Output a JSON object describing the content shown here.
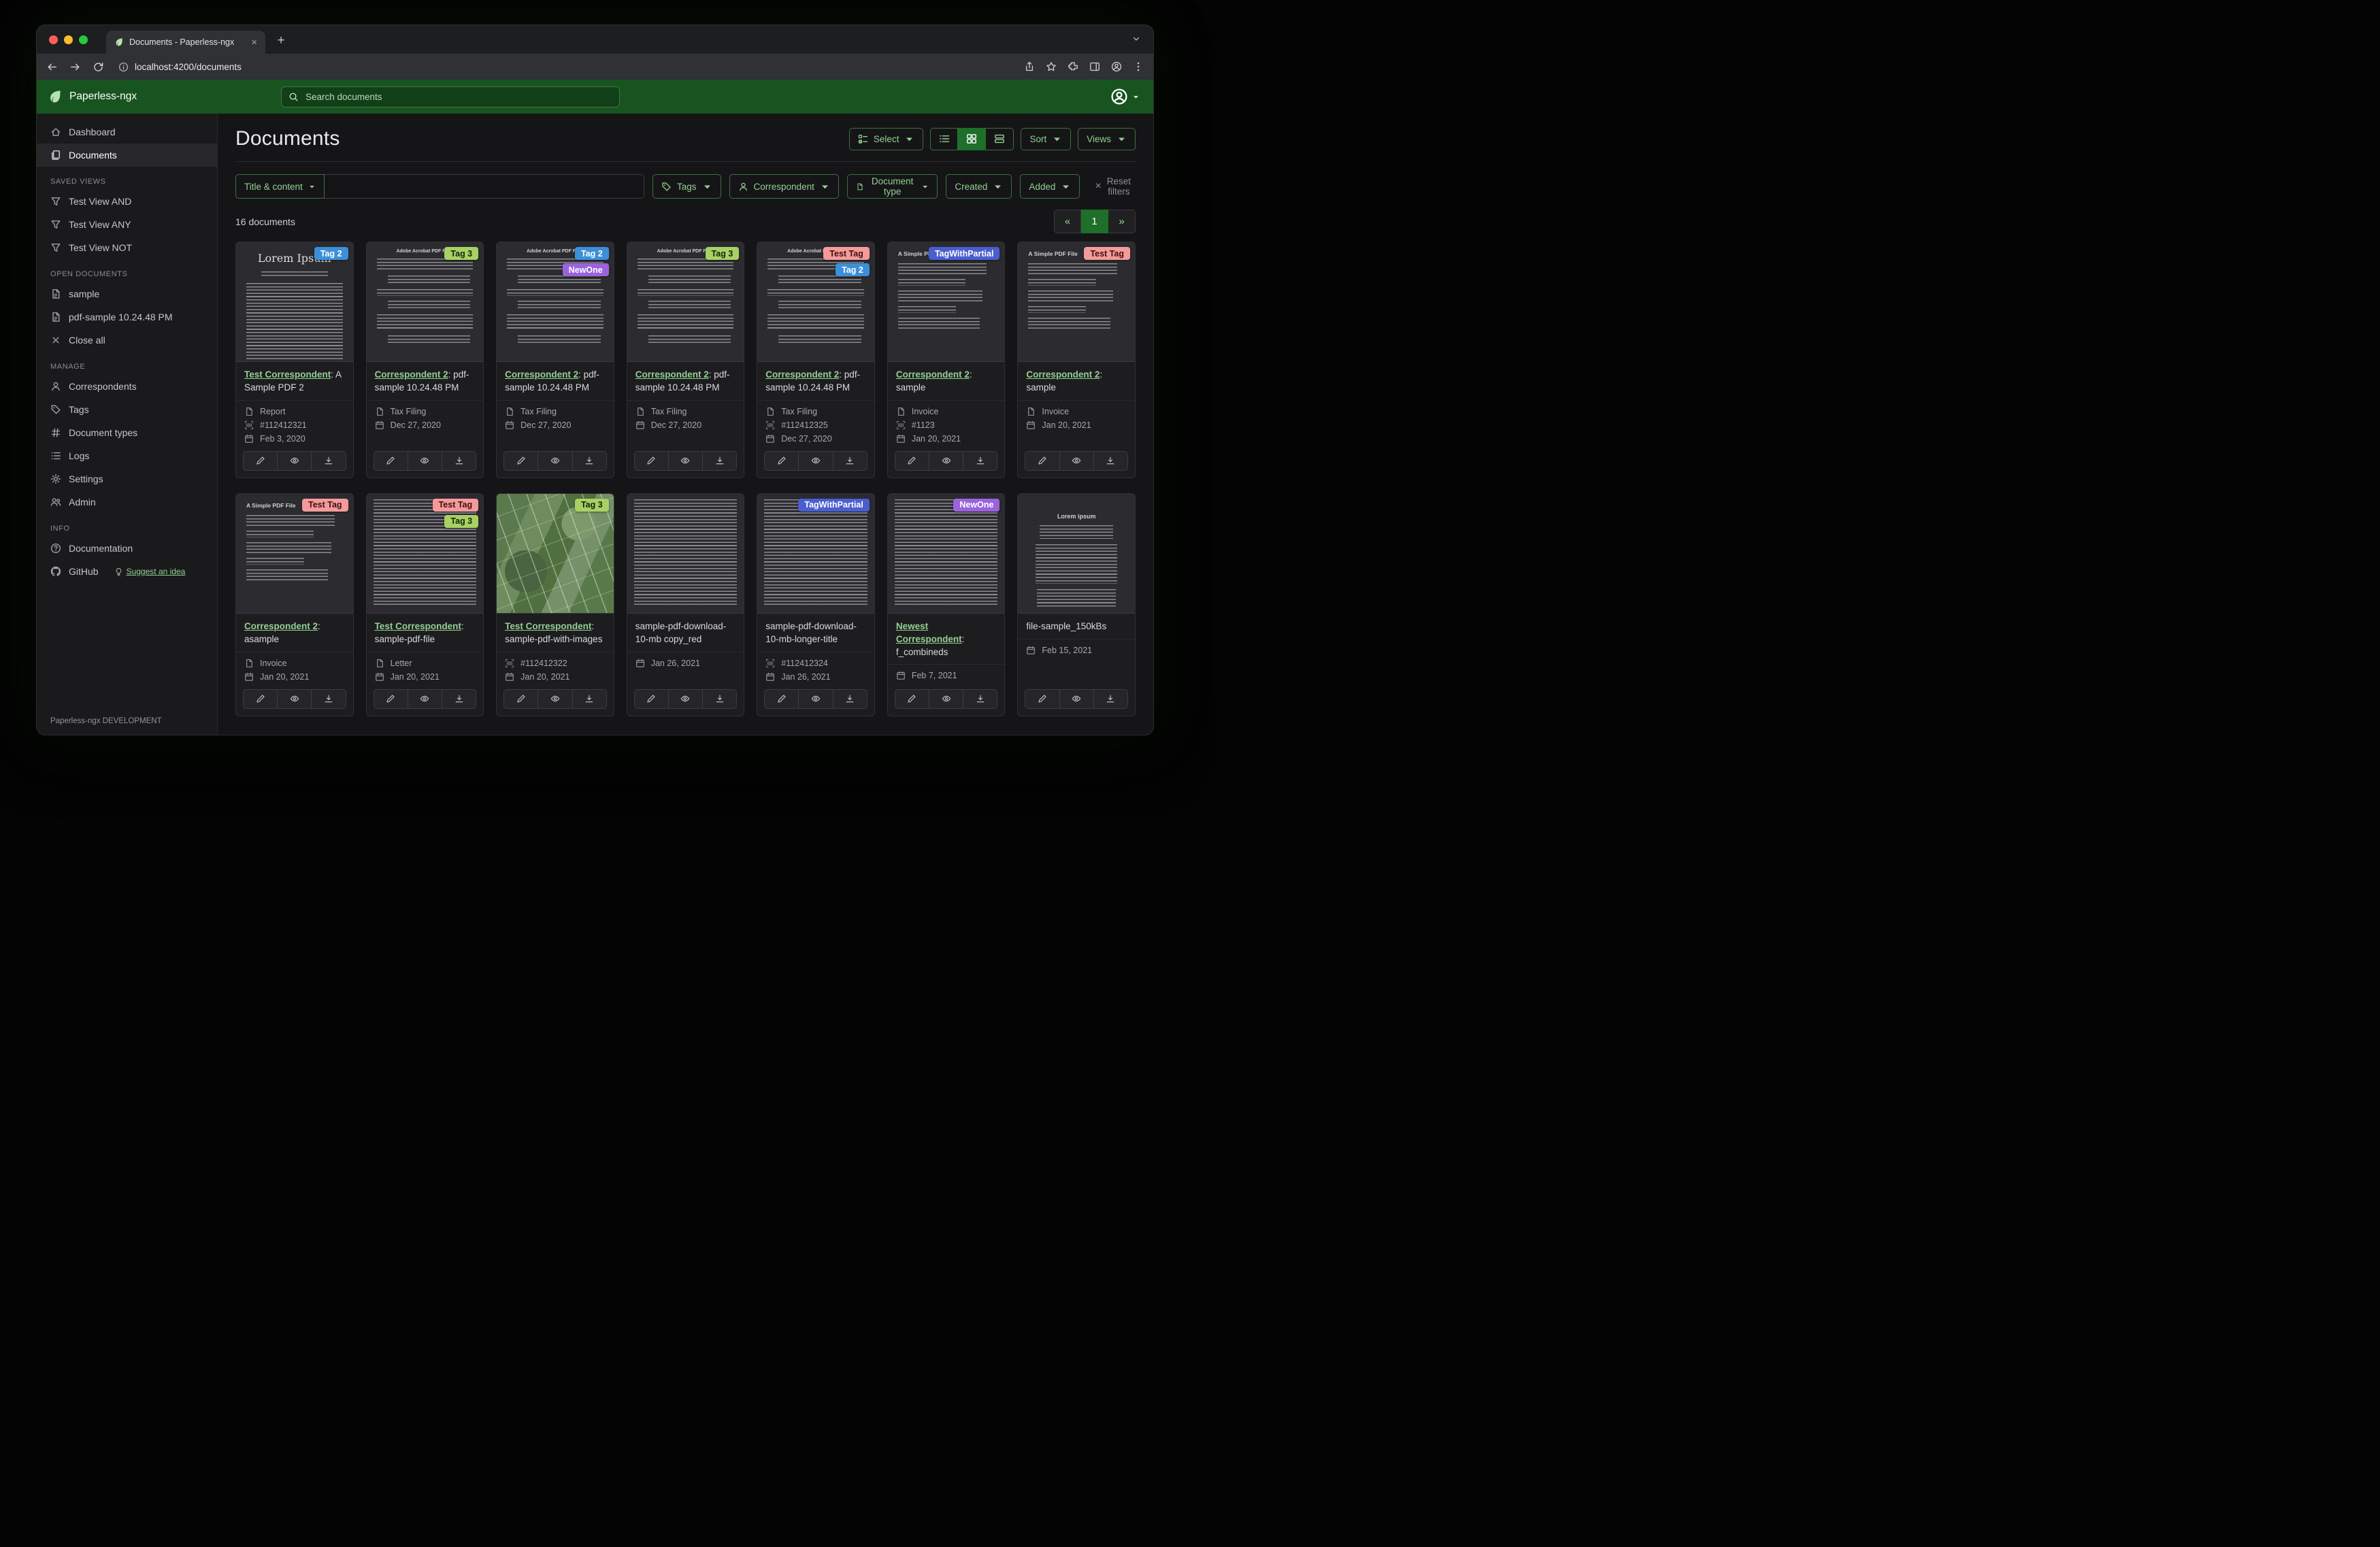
{
  "colors": {
    "header_green": "#17541f",
    "accent_green": "#94d092",
    "active_green": "#1e6f29"
  },
  "browser": {
    "tab": {
      "title": "Documents - Paperless-ngx",
      "close": "×"
    },
    "new_tab": "+",
    "url": "localhost:4200/documents"
  },
  "header": {
    "brand": "Paperless-ngx",
    "search_placeholder": "Search documents"
  },
  "sidebar": {
    "primary": [
      {
        "icon": "home",
        "label": "Dashboard",
        "active": false
      },
      {
        "icon": "files",
        "label": "Documents",
        "active": true
      }
    ],
    "sections": [
      {
        "title": "SAVED VIEWS",
        "items": [
          {
            "icon": "funnel",
            "label": "Test View AND"
          },
          {
            "icon": "funnel",
            "label": "Test View ANY"
          },
          {
            "icon": "funnel",
            "label": "Test View NOT"
          }
        ]
      },
      {
        "title": "OPEN DOCUMENTS",
        "items": [
          {
            "icon": "filetext",
            "label": "sample"
          },
          {
            "icon": "filetext",
            "label": "pdf-sample 10.24.48 PM"
          },
          {
            "icon": "x",
            "label": "Close all"
          }
        ]
      },
      {
        "title": "MANAGE",
        "items": [
          {
            "icon": "person",
            "label": "Correspondents"
          },
          {
            "icon": "tag",
            "label": "Tags"
          },
          {
            "icon": "hash",
            "label": "Document types"
          },
          {
            "icon": "list",
            "label": "Logs"
          },
          {
            "icon": "gear",
            "label": "Settings"
          },
          {
            "icon": "people",
            "label": "Admin"
          }
        ]
      },
      {
        "title": "INFO",
        "items": [
          {
            "icon": "question",
            "label": "Documentation"
          },
          {
            "icon": "github",
            "label": "GitHub",
            "extra": {
              "icon": "bulb",
              "label": "Suggest an idea"
            }
          }
        ]
      }
    ],
    "footer": "Paperless-ngx DEVELOPMENT"
  },
  "main": {
    "heading": "Documents",
    "toolbar": {
      "select": "Select",
      "sort": "Sort",
      "views": "Views"
    },
    "filters": {
      "title_content": "Title & content",
      "tags": "Tags",
      "correspondent": "Correspondent",
      "document_type": "Document type",
      "created": "Created",
      "added": "Added",
      "reset": "Reset filters",
      "reset_x": "×"
    },
    "count_text": "16 documents",
    "pagination": {
      "prev": "«",
      "page": "1",
      "next": "»"
    }
  },
  "icons": {
    "favicon": "leaf",
    "brand_logo": "leaf",
    "search": "magnifier",
    "user_menu": "person-circle",
    "back": "arrow-left",
    "forward": "arrow-right",
    "reload": "arrow-clockwise",
    "site_info": "info-circle",
    "share": "share-up",
    "bookmark": "star",
    "extensions": "puzzle",
    "side_panel": "panel",
    "profile": "person-circle",
    "menu": "three-dots-vertical",
    "dashboard": "house",
    "documents": "files",
    "saved_view": "funnel",
    "open_document": "file-text",
    "close_all": "x",
    "correspondents": "person",
    "tags": "tag",
    "document_types": "hash",
    "logs": "list",
    "settings": "gear",
    "admin": "people",
    "documentation": "question-circle",
    "github": "github-mark",
    "suggest": "lightbulb",
    "select": "ui-checks",
    "view_list": "list-ul",
    "view_grid": "grid-2x2",
    "view_detail": "list-rows",
    "doc_type_meta": "file",
    "asn_meta": "barcode-scan",
    "date_meta": "calendar",
    "edit": "pencil",
    "preview": "eye",
    "download": "download"
  },
  "tag_styles": {
    "Tag 2": {
      "bg": "#3c8fd9",
      "fg": "#ffffff"
    },
    "Tag 3": {
      "bg": "#a8d164",
      "fg": "#15230b"
    },
    "NewOne": {
      "bg": "#9a63dd",
      "fg": "#ffffff"
    },
    "Test Tag": {
      "bg": "#f59a9a",
      "fg": "#3f0f0f"
    },
    "TagWithPartial": {
      "bg": "#4a5ed0",
      "fg": "#ffffff"
    }
  },
  "cards": [
    {
      "thumb": {
        "kind": "lorem",
        "heading": "Lorem Ipsum"
      },
      "tags": [
        "Tag 2"
      ],
      "correspondent": "Test Correspondent",
      "title_rest": ": A Sample PDF 2",
      "meta": [
        {
          "icon": "doctype",
          "text": "Report"
        },
        {
          "icon": "asn",
          "text": "#112412321"
        },
        {
          "icon": "calendar",
          "text": "Feb 3, 2020"
        }
      ]
    },
    {
      "thumb": {
        "kind": "pdfguide",
        "heading": "Adobe Acrobat PDF Files"
      },
      "tags": [
        "Tag 3"
      ],
      "correspondent": "Correspondent 2",
      "title_rest": ": pdf-sample 10.24.48 PM",
      "meta": [
        {
          "icon": "doctype",
          "text": "Tax Filing"
        },
        {
          "icon": "calendar",
          "text": "Dec 27, 2020"
        }
      ]
    },
    {
      "thumb": {
        "kind": "pdfguide",
        "heading": "Adobe Acrobat PDF Files"
      },
      "tags": [
        "Tag 2",
        "NewOne"
      ],
      "correspondent": "Correspondent 2",
      "title_rest": ": pdf-sample 10.24.48 PM",
      "meta": [
        {
          "icon": "doctype",
          "text": "Tax Filing"
        },
        {
          "icon": "calendar",
          "text": "Dec 27, 2020"
        }
      ]
    },
    {
      "thumb": {
        "kind": "pdfguide",
        "heading": "Adobe Acrobat PDF Files"
      },
      "tags": [
        "Tag 3"
      ],
      "correspondent": "Correspondent 2",
      "title_rest": ": pdf-sample 10.24.48 PM",
      "meta": [
        {
          "icon": "doctype",
          "text": "Tax Filing"
        },
        {
          "icon": "calendar",
          "text": "Dec 27, 2020"
        }
      ]
    },
    {
      "thumb": {
        "kind": "pdfguide",
        "heading": "Adobe Acrobat PDF Files"
      },
      "tags": [
        "Test Tag",
        "Tag 2"
      ],
      "correspondent": "Correspondent 2",
      "title_rest": ": pdf-sample 10.24.48 PM",
      "meta": [
        {
          "icon": "doctype",
          "text": "Tax Filing"
        },
        {
          "icon": "asn",
          "text": "#112412325"
        },
        {
          "icon": "calendar",
          "text": "Dec 27, 2020"
        }
      ]
    },
    {
      "thumb": {
        "kind": "simple",
        "heading": "A Simple PDF File"
      },
      "tags": [
        "TagWithPartial"
      ],
      "correspondent": "Correspondent 2",
      "title_rest": ": sample",
      "meta": [
        {
          "icon": "doctype",
          "text": "Invoice"
        },
        {
          "icon": "asn",
          "text": "#1123"
        },
        {
          "icon": "calendar",
          "text": "Jan 20, 2021"
        }
      ]
    },
    {
      "thumb": {
        "kind": "simple",
        "heading": "A Simple PDF File"
      },
      "tags": [
        "Test Tag"
      ],
      "correspondent": "Correspondent 2",
      "title_rest": ": sample",
      "meta": [
        {
          "icon": "doctype",
          "text": "Invoice"
        },
        {
          "icon": "calendar",
          "text": "Jan 20, 2021"
        }
      ]
    },
    {
      "thumb": {
        "kind": "simple",
        "heading": "A Simple PDF File"
      },
      "tags": [
        "Test Tag"
      ],
      "correspondent": "Correspondent 2",
      "title_rest": ": asample",
      "meta": [
        {
          "icon": "doctype",
          "text": "Invoice"
        },
        {
          "icon": "calendar",
          "text": "Jan 20, 2021"
        }
      ]
    },
    {
      "thumb": {
        "kind": "text",
        "heading": ""
      },
      "tags": [
        "Test Tag",
        "Tag 3"
      ],
      "correspondent": "Test Correspondent",
      "title_rest": ": sample-pdf-file",
      "meta": [
        {
          "icon": "doctype",
          "text": "Letter"
        },
        {
          "icon": "calendar",
          "text": "Jan 20, 2021"
        }
      ]
    },
    {
      "thumb": {
        "kind": "map",
        "heading": ""
      },
      "tags": [
        "Tag 3"
      ],
      "correspondent": "Test Correspondent",
      "title_rest": ": sample-pdf-with-images",
      "meta": [
        {
          "icon": "asn",
          "text": "#112412322"
        },
        {
          "icon": "calendar",
          "text": "Jan 20, 2021"
        }
      ]
    },
    {
      "thumb": {
        "kind": "text",
        "heading": ""
      },
      "tags": [],
      "correspondent": null,
      "title_rest": "sample-pdf-download-10-mb copy_red",
      "meta": [
        {
          "icon": "calendar",
          "text": "Jan 26, 2021"
        }
      ]
    },
    {
      "thumb": {
        "kind": "text",
        "heading": ""
      },
      "tags": [
        "TagWithPartial"
      ],
      "correspondent": null,
      "title_rest": "sample-pdf-download-10-mb-longer-title",
      "meta": [
        {
          "icon": "asn",
          "text": "#112412324"
        },
        {
          "icon": "calendar",
          "text": "Jan 26, 2021"
        }
      ]
    },
    {
      "thumb": {
        "kind": "text",
        "heading": ""
      },
      "tags": [
        "NewOne"
      ],
      "correspondent": "Newest Correspondent",
      "title_rest": ": f_combineds",
      "meta": [
        {
          "icon": "calendar",
          "text": "Feb 7, 2021"
        }
      ]
    },
    {
      "thumb": {
        "kind": "loremcenter",
        "heading": "Lorem ipsum"
      },
      "tags": [],
      "correspondent": null,
      "title_rest": "file-sample_150kBs",
      "meta": [
        {
          "icon": "calendar",
          "text": "Feb 15, 2021"
        }
      ]
    }
  ]
}
